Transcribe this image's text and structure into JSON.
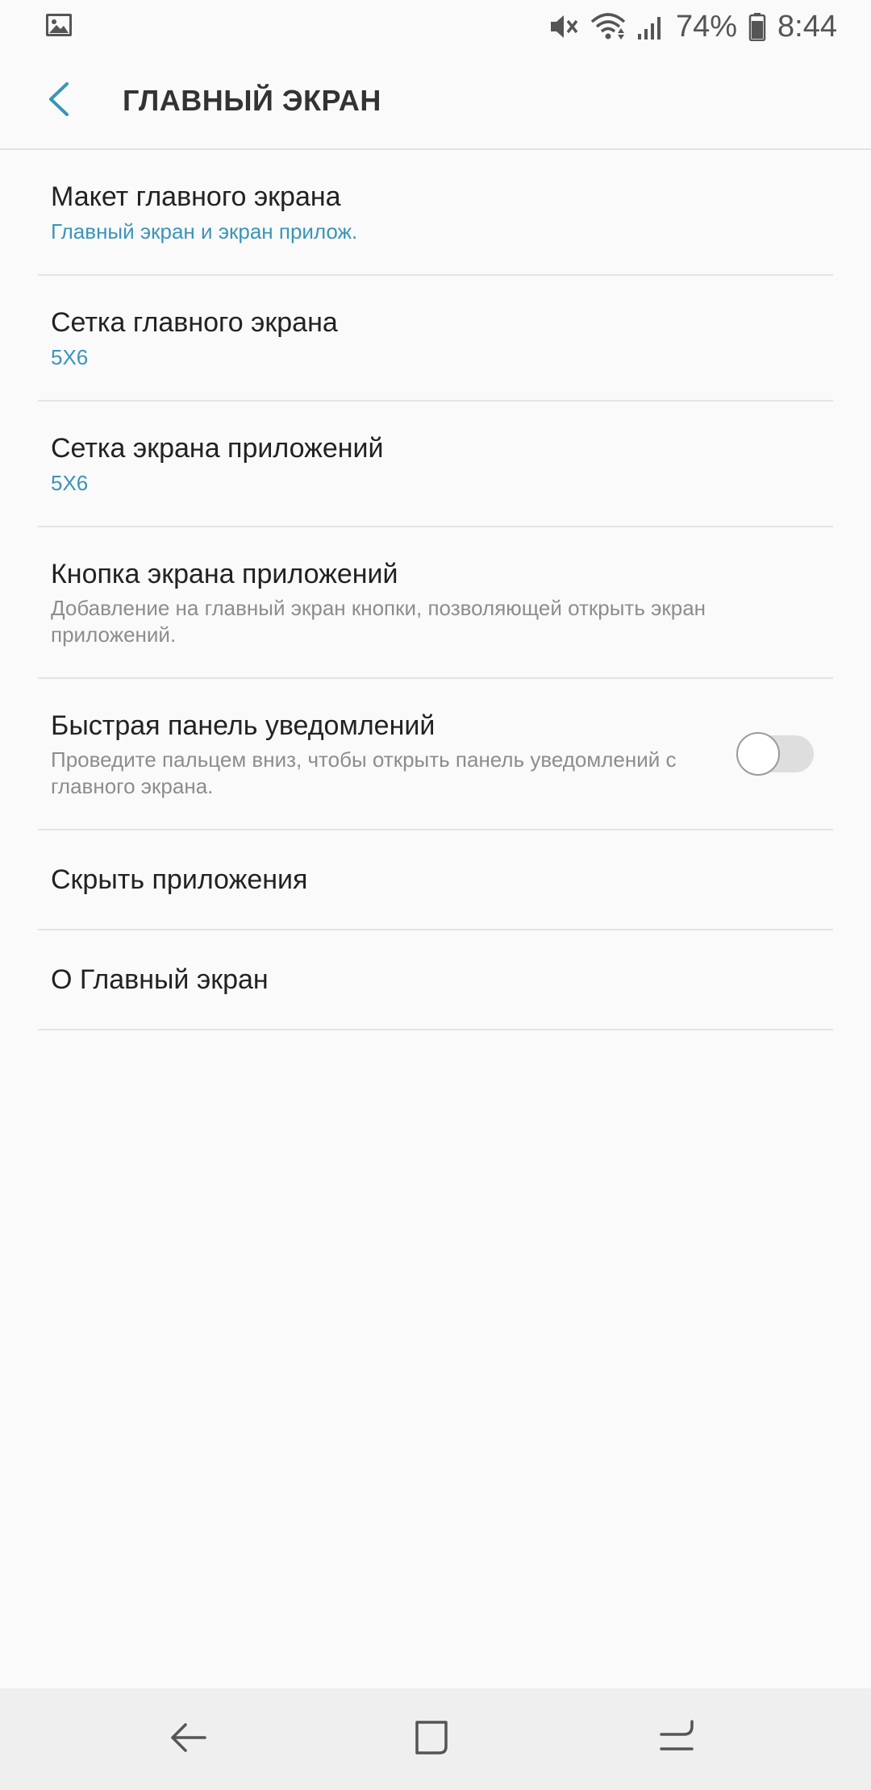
{
  "status_bar": {
    "battery_percent": "74%",
    "time": "8:44",
    "icons": [
      "gallery-notification-icon",
      "mute-icon",
      "wifi-icon",
      "signal-icon",
      "battery-icon"
    ]
  },
  "app_bar": {
    "title": "ГЛАВНЫЙ ЭКРАН",
    "back_icon": "back-arrow-icon"
  },
  "settings": {
    "items": [
      {
        "title": "Макет главного экрана",
        "subtitle": "Главный экран и экран прилож."
      },
      {
        "title": "Сетка главного экрана",
        "subtitle": "5X6"
      },
      {
        "title": "Сетка экрана приложений",
        "subtitle": "5X6"
      },
      {
        "title": "Кнопка экрана приложений",
        "subtitle": "Добавление на главный экран кнопки, позволяющей открыть экран приложений."
      },
      {
        "title": "Быстрая панель уведомлений",
        "subtitle": "Проведите пальцем вниз, чтобы открыть панель уведомлений с главного экрана.",
        "toggle": false
      },
      {
        "title": "Скрыть приложения"
      },
      {
        "title": "О Главный экран"
      }
    ]
  },
  "colors": {
    "accent": "#3a95b8",
    "background": "#fafafa",
    "nav_bar": "#efefef"
  },
  "nav_bar": {
    "icons": [
      "nav-back-icon",
      "nav-home-icon",
      "nav-recents-icon"
    ]
  }
}
